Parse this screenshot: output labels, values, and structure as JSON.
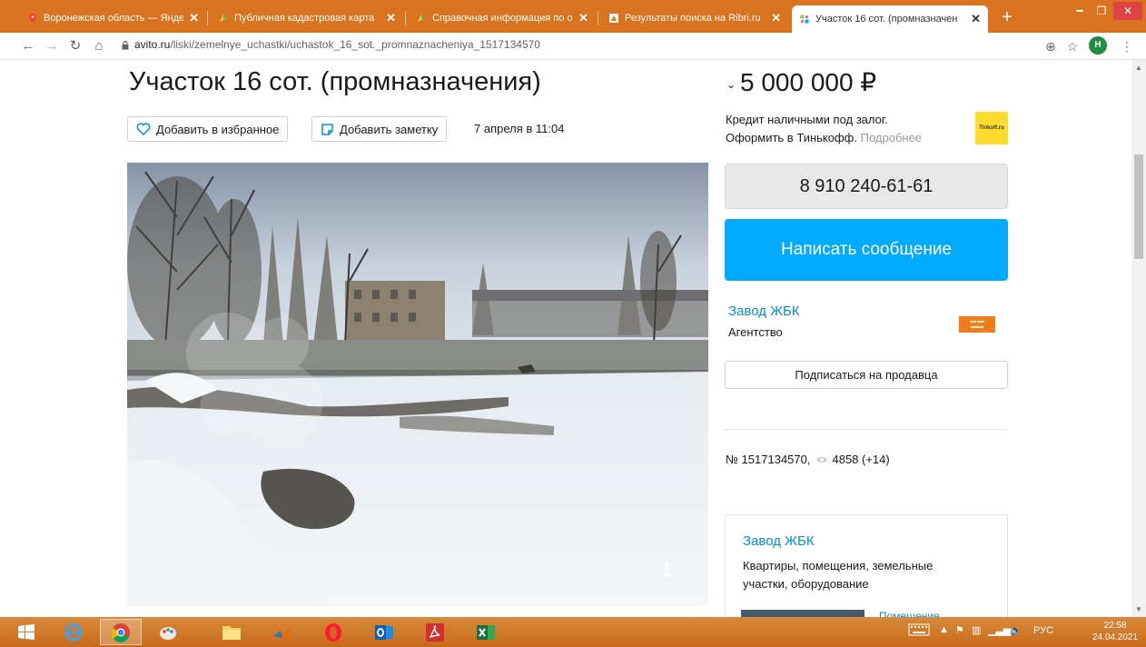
{
  "browser": {
    "tabs": [
      {
        "label": "Воронежская область — Яндекс",
        "favicon": "map-pin-icon",
        "active": false
      },
      {
        "label": "Публичная кадастровая карта",
        "favicon": "pkk-icon",
        "active": false
      },
      {
        "label": "Справочная информация по о",
        "favicon": "pkk-icon",
        "active": false
      },
      {
        "label": "Результаты поиска на Ribri.ru",
        "favicon": "ribri-icon",
        "active": false
      },
      {
        "label": "Участок 16 сот. (промназначен",
        "favicon": "avito-icon",
        "active": true
      }
    ],
    "new_tab_label": "+",
    "url_host": "avito.ru",
    "url_path": "/liski/zemelnye_uchastki/uchastok_16_sot._promnaznacheniya_1517134570",
    "profile_initial": "Н",
    "colors": {
      "tabstrip": "#d9731f",
      "accent": "#00aaff",
      "link": "#0091d9"
    }
  },
  "listing": {
    "title": "Участок 16 сот. (промназначения)",
    "add_favorite_label": "Добавить в избранное",
    "add_note_label": "Добавить заметку",
    "date": "7 апреля в 11:04",
    "photo_index": "1",
    "price": "5 000 000 ₽",
    "credit_line1": "Кредит наличными под залог.",
    "credit_line2": "Оформить в Тинькофф.",
    "credit_more": "Подробнее",
    "credit_logo": "Tinkoff.ru",
    "phone": "8 910 240-61-61",
    "message_label": "Написать сообщение",
    "seller_name": "Завод ЖБК",
    "seller_type": "Агентство",
    "subscribe_label": "Подписаться на продавца",
    "ad_number": "№ 1517134570,",
    "views": "4858 (+14)"
  },
  "seller_card": {
    "title": "Завод ЖБК",
    "description": "Квартиры, помещения, земельные участки, оборудование",
    "link": "Помещение"
  },
  "taskbar": {
    "apps": [
      "windows-start-icon",
      "internet-explorer-icon",
      "chrome-icon",
      "paint-icon",
      "file-explorer-icon",
      "matlab-icon",
      "opera-icon",
      "outlook-icon",
      "acrobat-icon",
      "excel-icon"
    ],
    "language": "РУС",
    "time": "22:58",
    "date": "24.04.2021"
  }
}
